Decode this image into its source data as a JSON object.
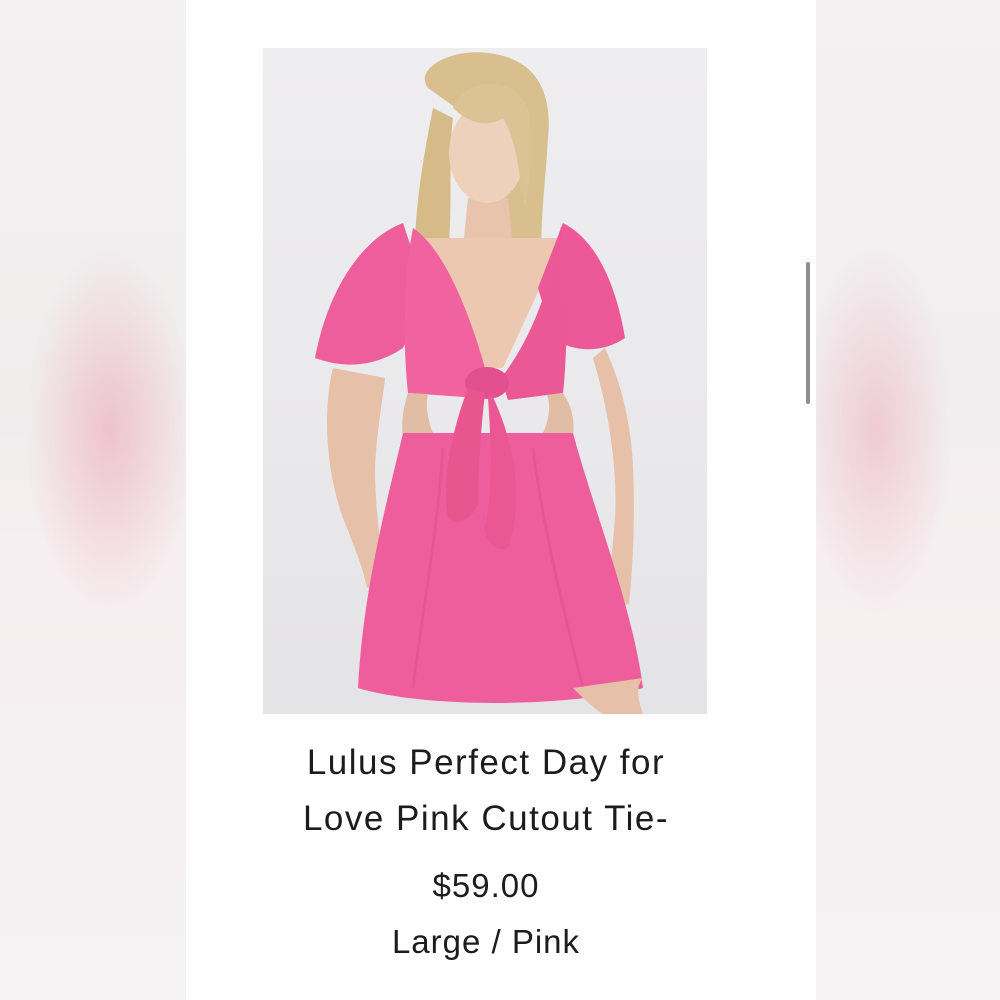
{
  "product": {
    "title_line1": "Lulus Perfect Day for",
    "title_line2": "Love Pink Cutout Tie-",
    "price": "$59.00",
    "variant": "Large / Pink",
    "image_icon": "product-photo-pink-dress"
  },
  "colors": {
    "dress": "#ef5a9a",
    "background": "#ffffff",
    "text": "#1c1c1c"
  }
}
